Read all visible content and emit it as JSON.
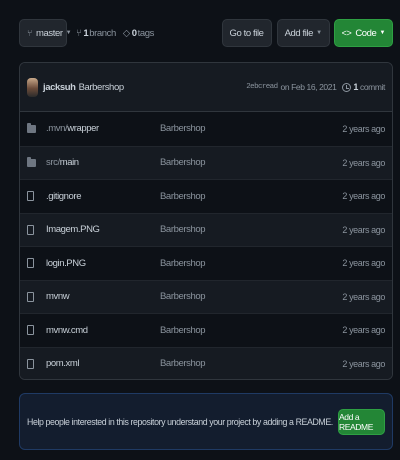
{
  "toolbar": {
    "branch": "master",
    "branch_count": "1",
    "branch_label": "branch",
    "tag_count": "0",
    "tag_label": "tags",
    "go_to_file": "Go to file",
    "add_file": "Add file",
    "code": "Code"
  },
  "commit": {
    "author": "jacksuh",
    "message": "Barbershop",
    "hash": "2ebcread",
    "date": "on Feb 16, 2021",
    "count": "1",
    "count_label": "commit"
  },
  "files": [
    {
      "type": "folder",
      "prefix": ".mvn/",
      "name": "wrapper",
      "message": "Barbershop",
      "age": "2 years ago"
    },
    {
      "type": "folder",
      "prefix": "src/",
      "name": "main",
      "message": "Barbershop",
      "age": "2 years ago"
    },
    {
      "type": "file",
      "prefix": "",
      "name": ".gitignore",
      "message": "Barbershop",
      "age": "2 years ago"
    },
    {
      "type": "file",
      "prefix": "",
      "name": "Imagem.PNG",
      "message": "Barbershop",
      "age": "2 years ago"
    },
    {
      "type": "file",
      "prefix": "",
      "name": "login.PNG",
      "message": "Barbershop",
      "age": "2 years ago"
    },
    {
      "type": "file",
      "prefix": "",
      "name": "mvnw",
      "message": "Barbershop",
      "age": "2 years ago"
    },
    {
      "type": "file",
      "prefix": "",
      "name": "mvnw.cmd",
      "message": "Barbershop",
      "age": "2 years ago"
    },
    {
      "type": "file",
      "prefix": "",
      "name": "pom.xml",
      "message": "Barbershop",
      "age": "2 years ago"
    }
  ],
  "readme": {
    "text": "Help people interested in this repository understand your project by adding a README.",
    "button": "Add a README"
  },
  "colors": {
    "background": "#0d1117",
    "primary_button": "#238636",
    "readme_banner": "#131d2e"
  }
}
